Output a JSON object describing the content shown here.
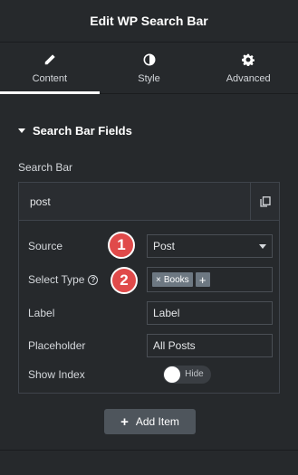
{
  "header": {
    "title": "Edit WP Search Bar"
  },
  "tabs": [
    {
      "label": "Content",
      "icon": "pencil-icon",
      "active": true
    },
    {
      "label": "Style",
      "icon": "contrast-icon",
      "active": false
    },
    {
      "label": "Advanced",
      "icon": "gear-icon",
      "active": false
    }
  ],
  "section": {
    "title": "Search Bar Fields"
  },
  "repeater": {
    "label": "Search Bar",
    "item_title": "post",
    "fields": {
      "source": {
        "label": "Source",
        "value": "Post"
      },
      "select_type": {
        "label": "Select Type",
        "chip": "Books",
        "chip_remove": "×",
        "add": "+"
      },
      "label": {
        "label": "Label",
        "value": "Label"
      },
      "placeholder": {
        "label": "Placeholder",
        "value": "All Posts"
      },
      "show_index": {
        "label": "Show Index",
        "toggle_text": "Hide",
        "on": false
      }
    }
  },
  "badges": [
    "1",
    "2"
  ],
  "add_item": {
    "plus": "+",
    "label": "Add Item"
  },
  "colors": {
    "background": "#26292c",
    "badge": "#e04a4a",
    "chip": "#6d7882"
  }
}
